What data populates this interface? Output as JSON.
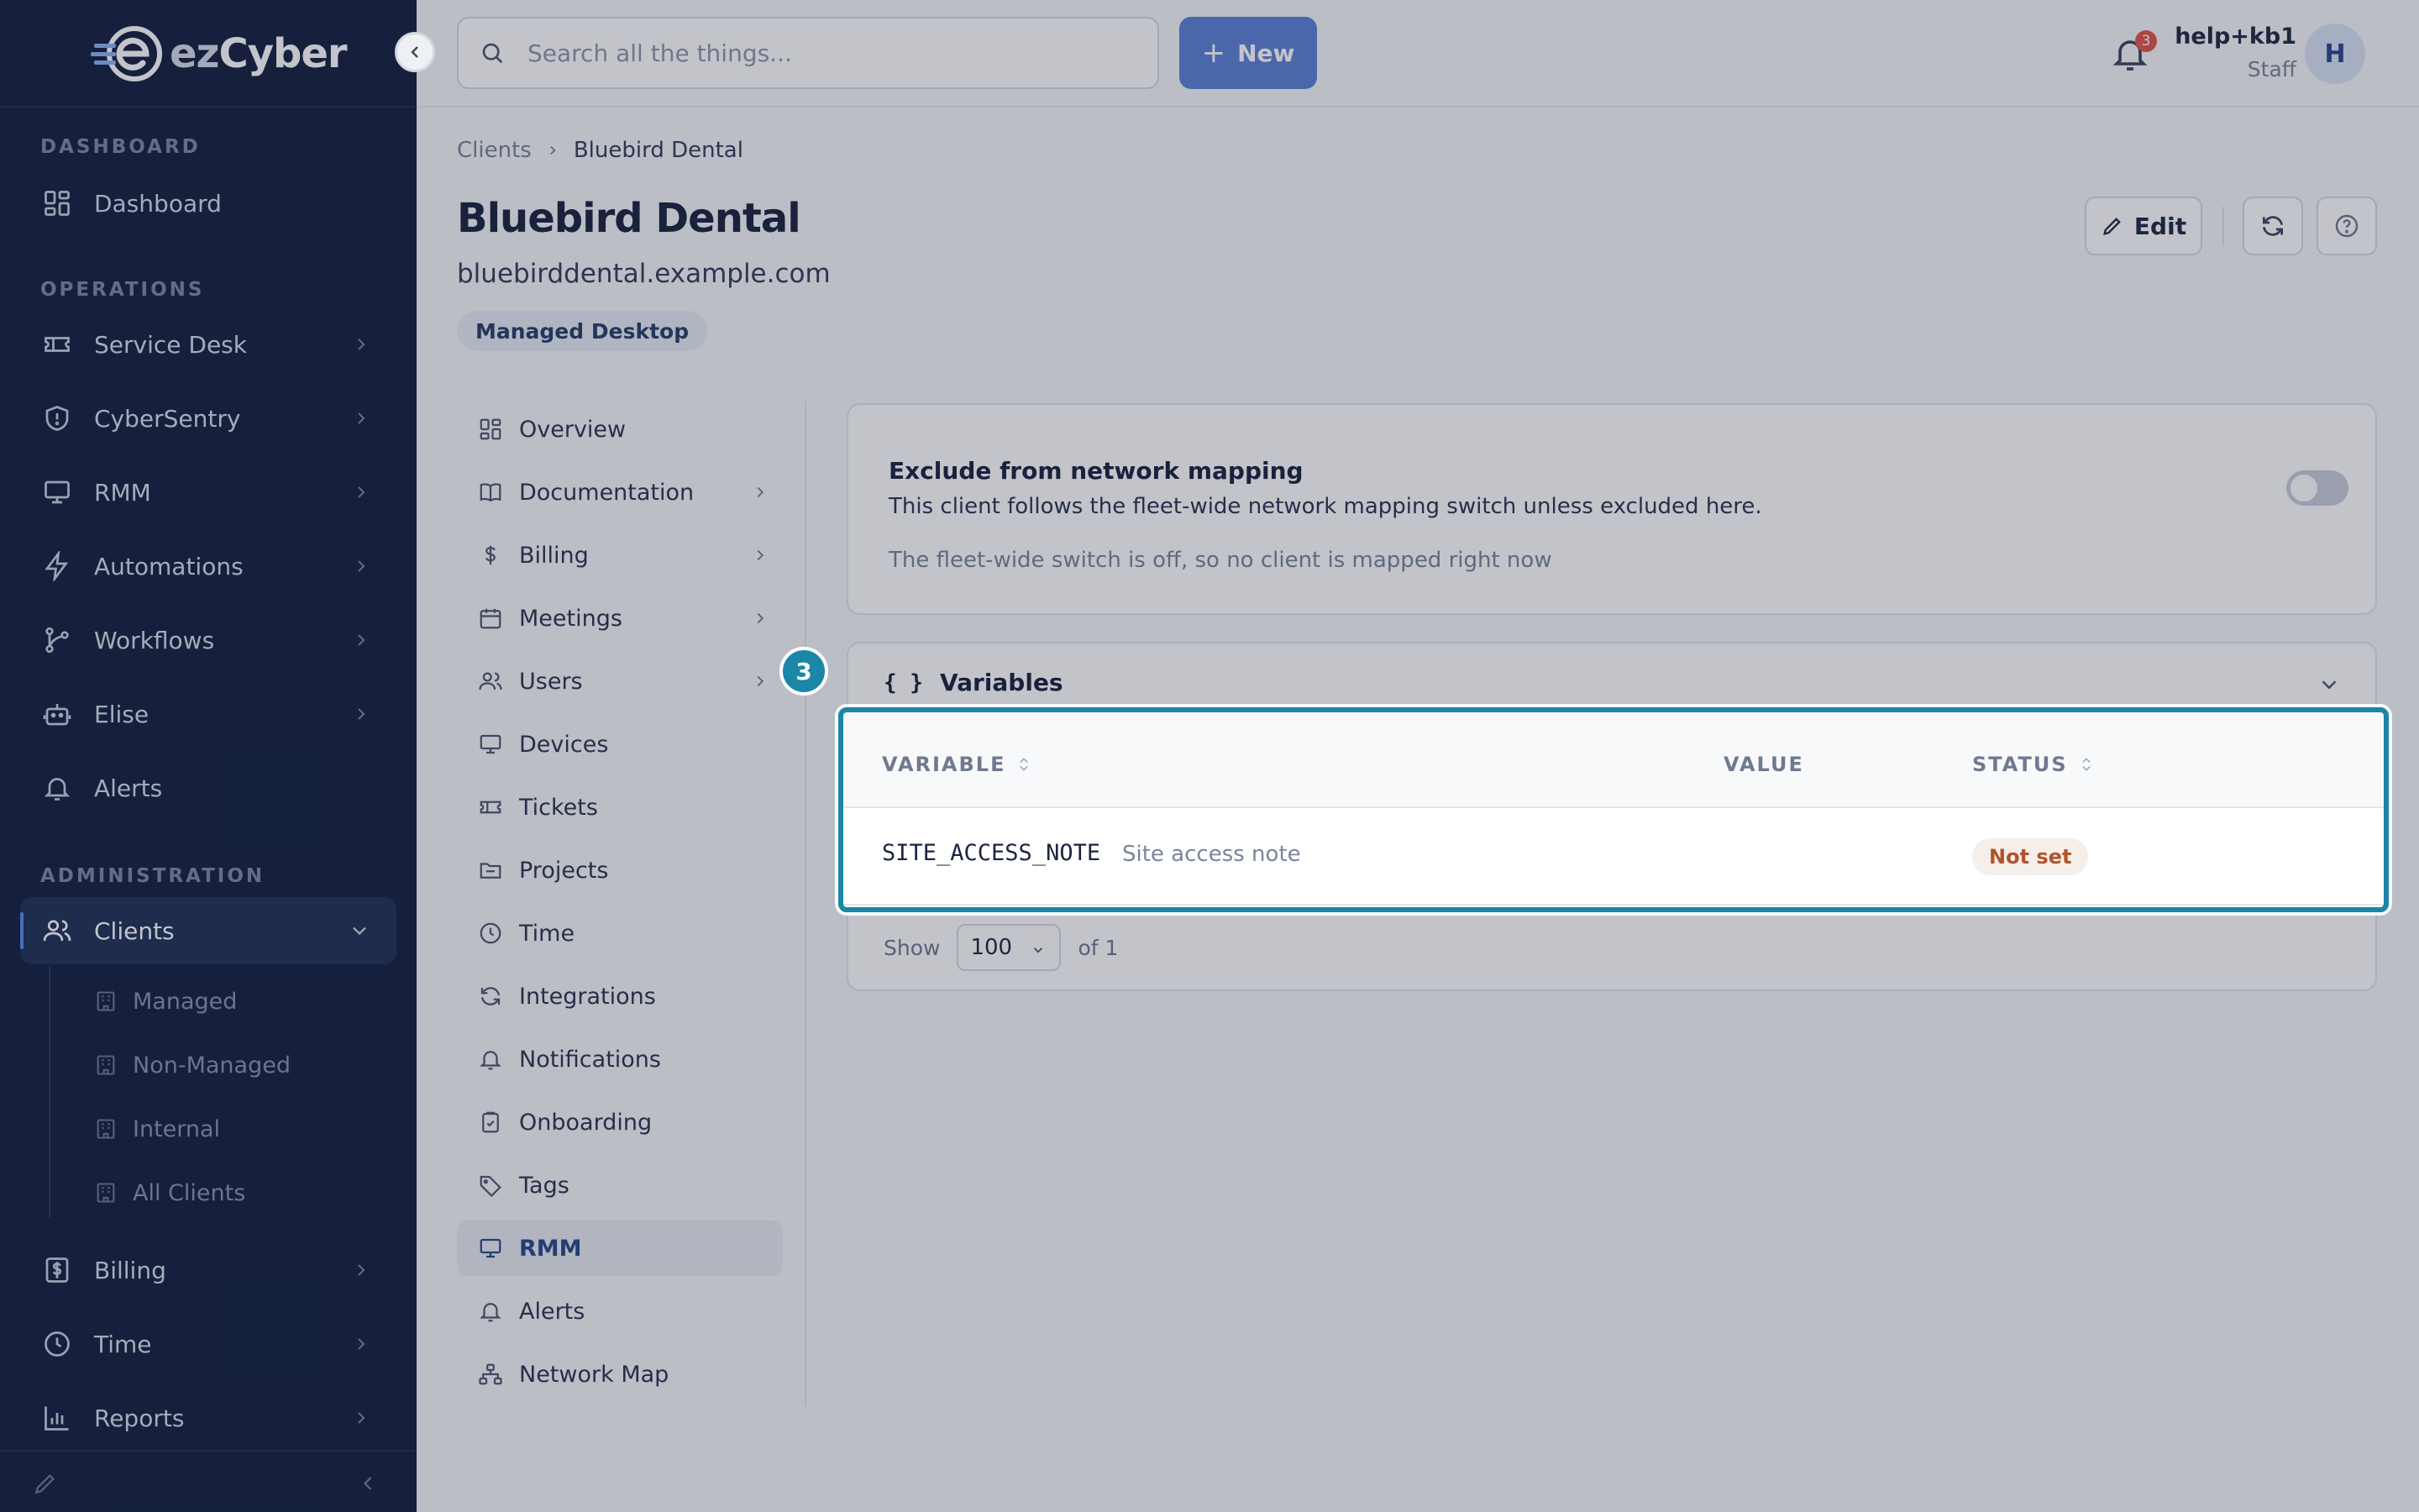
{
  "brand": {
    "name_prefix": "ez",
    "name_suffix": "Cyber"
  },
  "topbar": {
    "search_placeholder": "Search all the things...",
    "new_label": "New",
    "notifications_count": "3",
    "user_name": "help+kb1",
    "user_role": "Staff",
    "avatar_initial": "H"
  },
  "sidebar": {
    "sections": {
      "dashboard": "DASHBOARD",
      "operations": "OPERATIONS",
      "administration": "ADMINISTRATION"
    },
    "items": [
      {
        "label": "Dashboard",
        "icon": "dashboard-icon"
      },
      {
        "label": "Service Desk",
        "icon": "ticket-icon"
      },
      {
        "label": "CyberSentry",
        "icon": "shield-icon"
      },
      {
        "label": "RMM",
        "icon": "monitor-icon"
      },
      {
        "label": "Automations",
        "icon": "bolt-icon"
      },
      {
        "label": "Workflows",
        "icon": "workflow-icon"
      },
      {
        "label": "Elise",
        "icon": "robot-icon"
      },
      {
        "label": "Alerts",
        "icon": "bell-icon"
      },
      {
        "label": "Clients",
        "icon": "users-icon"
      },
      {
        "label": "Billing",
        "icon": "dollar-icon"
      },
      {
        "label": "Time",
        "icon": "clock-icon"
      },
      {
        "label": "Reports",
        "icon": "chart-icon"
      }
    ],
    "client_subitems": [
      "Managed",
      "Non-Managed",
      "Internal",
      "All Clients"
    ]
  },
  "breadcrumb": {
    "root": "Clients",
    "current": "Bluebird Dental"
  },
  "client": {
    "title": "Bluebird Dental",
    "domain": "bluebirddental.example.com",
    "tag": "Managed Desktop",
    "edit_label": "Edit"
  },
  "subnav": [
    {
      "label": "Overview",
      "icon": "grid-icon"
    },
    {
      "label": "Documentation",
      "icon": "book-icon"
    },
    {
      "label": "Billing",
      "icon": "dollar-icon"
    },
    {
      "label": "Meetings",
      "icon": "calendar-icon"
    },
    {
      "label": "Users",
      "icon": "users-icon"
    },
    {
      "label": "Devices",
      "icon": "monitor-icon"
    },
    {
      "label": "Tickets",
      "icon": "ticket-icon"
    },
    {
      "label": "Projects",
      "icon": "folder-icon"
    },
    {
      "label": "Time",
      "icon": "clock-icon"
    },
    {
      "label": "Integrations",
      "icon": "sync-icon"
    },
    {
      "label": "Notifications",
      "icon": "bell-icon"
    },
    {
      "label": "Onboarding",
      "icon": "clipboard-icon"
    },
    {
      "label": "Tags",
      "icon": "tag-icon"
    },
    {
      "label": "RMM",
      "icon": "monitor-icon"
    },
    {
      "label": "Alerts",
      "icon": "bell-icon"
    },
    {
      "label": "Network Map",
      "icon": "network-icon"
    }
  ],
  "network_mapping": {
    "title": "Exclude from network mapping",
    "description": "This client follows the fleet-wide network mapping switch unless excluded here.",
    "note": "The fleet-wide switch is off, so no client is mapped right now",
    "excluded": false
  },
  "variables": {
    "title": "Variables",
    "columns": [
      "VARIABLE",
      "VALUE",
      "STATUS"
    ],
    "rows": [
      {
        "key": "SITE_ACCESS_NOTE",
        "label": "Site access note",
        "value": "",
        "status": "Not set"
      }
    ],
    "pager": {
      "show_label": "Show",
      "page_size": "100",
      "of_label": "of 1"
    }
  },
  "tutorial": {
    "step": "3"
  },
  "colors": {
    "sidebar_bg": "#172340",
    "accent": "#5f82d6",
    "highlight": "#1b86a8",
    "status_not_set": "#b0532b"
  }
}
